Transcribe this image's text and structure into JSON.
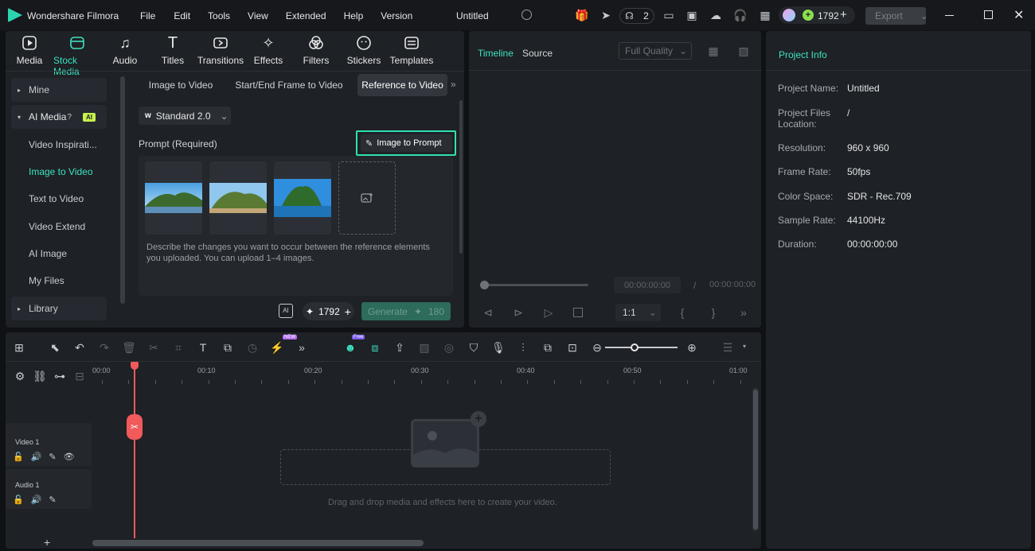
{
  "titlebar": {
    "app_name": "Wondershare Filmora",
    "menus": [
      "File",
      "Edit",
      "Tools",
      "View",
      "Extended",
      "Help",
      "Version"
    ],
    "project_title": "Untitled",
    "collab_count": "2",
    "credits": "1792",
    "export_label": "Export"
  },
  "media_tabs": [
    {
      "label": "Media",
      "icon": "media-icon"
    },
    {
      "label": "Stock Media",
      "icon": "stock-media-icon",
      "active": true
    },
    {
      "label": "Audio",
      "icon": "audio-icon"
    },
    {
      "label": "Titles",
      "icon": "titles-icon"
    },
    {
      "label": "Transitions",
      "icon": "transitions-icon"
    },
    {
      "label": "Effects",
      "icon": "effects-icon"
    },
    {
      "label": "Filters",
      "icon": "filters-icon"
    },
    {
      "label": "Stickers",
      "icon": "stickers-icon"
    },
    {
      "label": "Templates",
      "icon": "templates-icon"
    }
  ],
  "sidebar": {
    "mine": "Mine",
    "ai_media": "AI Media",
    "ai_badge": "AI",
    "items": [
      "Video Inspirati...",
      "Image to Video",
      "Text to Video",
      "Video Extend",
      "AI Image",
      "My Files"
    ],
    "library": "Library"
  },
  "ai_panel": {
    "tabs": [
      "Image to Video",
      "Start/End Frame to Video",
      "Reference to Video"
    ],
    "model": "Standard 2.0",
    "prompt_label": "Prompt (Required)",
    "image_to_prompt": "Image to Prompt",
    "description": "Describe the changes you want to occur between the reference elements you uploaded. You can upload 1–4 images.",
    "credits": "1792",
    "generate_label": "Generate",
    "generate_cost": "180"
  },
  "preview": {
    "tab_timeline": "Timeline",
    "tab_source": "Source",
    "quality": "Full Quality",
    "time_current": "00:00:00:00",
    "time_sep": "/",
    "time_total": "00:00:00:00",
    "ratio": "1:1"
  },
  "project_info": {
    "header": "Project Info",
    "rows": [
      {
        "k": "Project Name:",
        "v": "Untitled"
      },
      {
        "k": "Project Files Location:",
        "v": "/"
      },
      {
        "k": "Resolution:",
        "v": "960 x 960"
      },
      {
        "k": "Frame Rate:",
        "v": "50fps"
      },
      {
        "k": "Color Space:",
        "v": "SDR - Rec.709"
      },
      {
        "k": "Sample Rate:",
        "v": "44100Hz"
      },
      {
        "k": "Duration:",
        "v": "00:00:00:00"
      }
    ]
  },
  "timeline": {
    "ruler": [
      "00:00",
      "00:10",
      "00:20",
      "00:30",
      "00:40",
      "00:50",
      "01:00"
    ],
    "video_track": "Video 1",
    "audio_track": "Audio 1",
    "drop_hint": "Drag and drop media and effects here to create your video.",
    "badge_new": "NEW",
    "badge_free": "Free"
  },
  "colors": {
    "accent": "#3ee1c1",
    "playhead": "#f05a5a",
    "highlight_border": "#2fe0b3"
  }
}
